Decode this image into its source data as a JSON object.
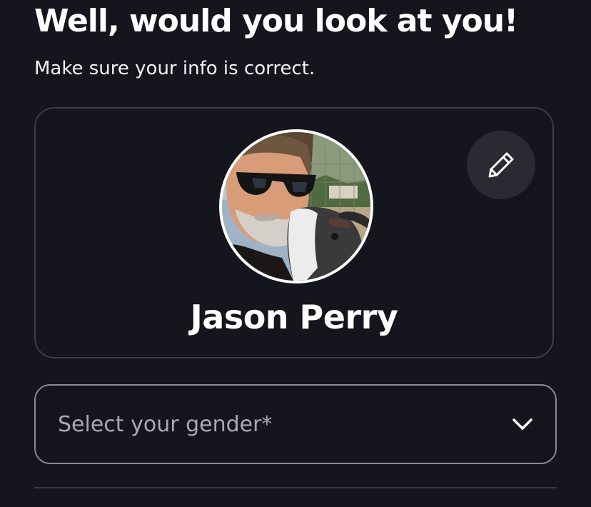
{
  "header": {
    "title": "Well, would you look at you!",
    "subtitle": "Make sure your info is correct."
  },
  "profile": {
    "name": "Jason Perry",
    "avatar_icon": "profile-photo",
    "edit_icon": "pencil-icon"
  },
  "gender_select": {
    "placeholder": "Select your gender*",
    "icon": "chevron-down-icon"
  },
  "colors": {
    "background": "#15151d",
    "card_border": "#3d3d47",
    "edit_button_bg": "#2a2a33",
    "text": "#ffffff",
    "placeholder": "#a9a9b2"
  }
}
